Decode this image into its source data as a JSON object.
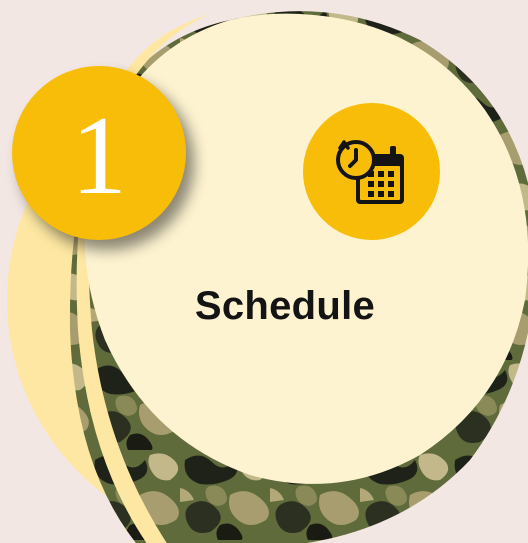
{
  "step": {
    "number": "1",
    "title": "Schedule",
    "icon": "calendar-clock-icon"
  },
  "colors": {
    "background": "#f3e7e3",
    "circle_fill": "#fdf3d0",
    "accent": "#f8bd08",
    "camo_base": "#5c6b3a",
    "icon_stroke": "#141414",
    "number_text": "#ffffff",
    "title_text": "#141414"
  }
}
